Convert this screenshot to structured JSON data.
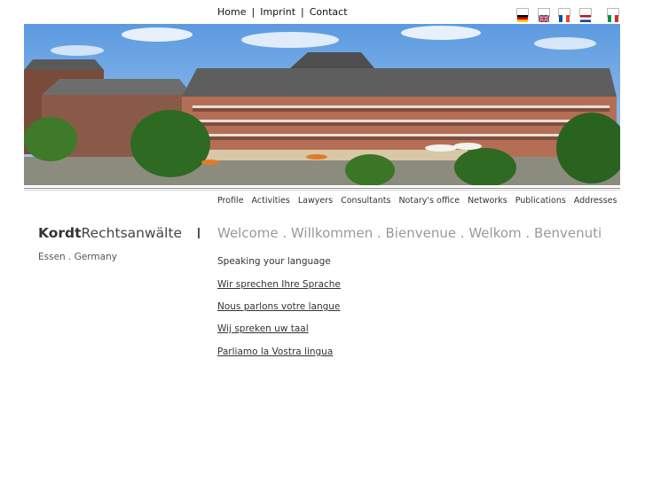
{
  "top_nav": {
    "home": "Home",
    "separator": "|",
    "imprint": "Imprint",
    "contact": "Contact"
  },
  "flags": [
    {
      "name": "german-flag-icon",
      "colors": [
        "#000000",
        "#dd0000",
        "#ffce00"
      ]
    },
    {
      "name": "uk-flag-icon",
      "colors": [
        "#012169",
        "#ffffff",
        "#c8102e"
      ]
    },
    {
      "name": "french-flag-icon",
      "colors": [
        "#0055a4",
        "#ffffff",
        "#ef4135"
      ]
    },
    {
      "name": "dutch-flag-icon",
      "colors": [
        "#ae1c28",
        "#ffffff",
        "#21468b"
      ]
    },
    {
      "name": "italian-flag-icon",
      "colors": [
        "#009246",
        "#ffffff",
        "#ce2b37"
      ]
    }
  ],
  "sub_nav": [
    "Profile",
    "Activities",
    "Lawyers",
    "Consultants",
    "Notary's office",
    "Networks",
    "Publications",
    "Addresses"
  ],
  "brand": {
    "bold": "Kordt",
    "rest": "Rechtsanwälte"
  },
  "location": "Essen . Germany",
  "welcome": "Welcome . Willkommen . Bienvenue . Welkom . Benvenuti",
  "languages": [
    {
      "text": "Speaking your language"
    },
    {
      "text": "Wir sprechen Ihre Sprache"
    },
    {
      "text": "Nous parlons votre langue"
    },
    {
      "text": "Wij spreken uw taal"
    },
    {
      "text": "Parliamo la Vostra lingua"
    }
  ]
}
